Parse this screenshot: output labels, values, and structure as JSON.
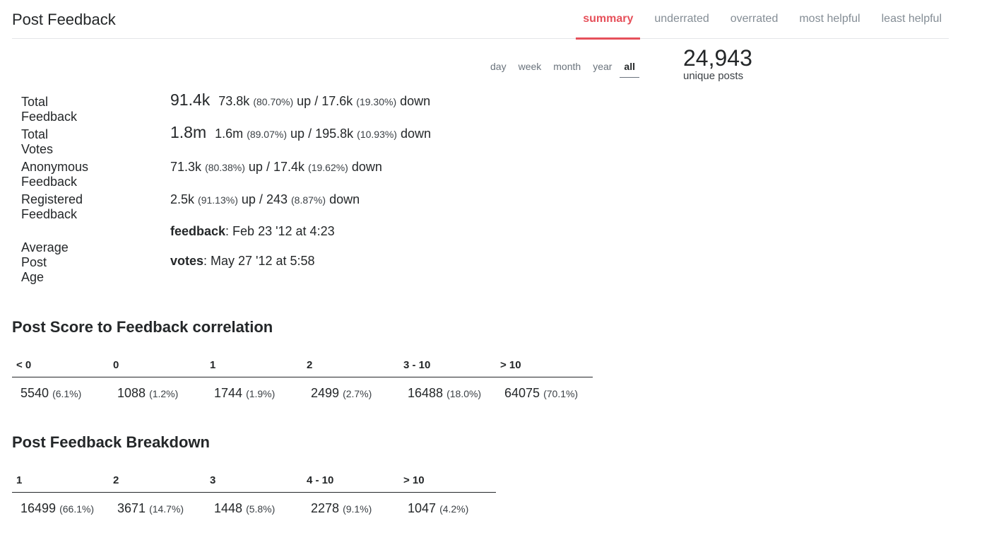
{
  "header": {
    "title": "Post Feedback",
    "tabs": [
      {
        "label": "summary",
        "active": true
      },
      {
        "label": "underrated",
        "active": false
      },
      {
        "label": "overrated",
        "active": false
      },
      {
        "label": "most helpful",
        "active": false
      },
      {
        "label": "least helpful",
        "active": false
      }
    ],
    "accent_color": "#e6505a"
  },
  "periods": [
    {
      "label": "day",
      "active": false
    },
    {
      "label": "week",
      "active": false
    },
    {
      "label": "month",
      "active": false
    },
    {
      "label": "year",
      "active": false
    },
    {
      "label": "all",
      "active": true
    }
  ],
  "unique_posts": {
    "count": "24,943",
    "label": "unique posts"
  },
  "stats": {
    "total_feedback": {
      "label": "Total Feedback",
      "total": "91.4k",
      "up": "73.8k",
      "up_pct": "(80.70%)",
      "down": "17.6k",
      "down_pct": "(19.30%)"
    },
    "total_votes": {
      "label": "Total Votes",
      "total": "1.8m",
      "up": "1.6m",
      "up_pct": "(89.07%)",
      "down": "195.8k",
      "down_pct": "(10.93%)"
    },
    "anonymous_feedback": {
      "label": "Anonymous Feedback",
      "up": "71.3k",
      "up_pct": "(80.38%)",
      "down": "17.4k",
      "down_pct": "(19.62%)"
    },
    "registered_feedback": {
      "label": "Registered Feedback",
      "up": "2.5k",
      "up_pct": "(91.13%)",
      "down": "243",
      "down_pct": "(8.87%)"
    },
    "up_word": "up",
    "down_word": "down",
    "separator": "/",
    "average_post_age": {
      "label": "Average Post Age",
      "feedback_key": "feedback",
      "feedback_value": ": Feb 23 '12 at 4:23",
      "votes_key": "votes",
      "votes_value": ": May 27 '12 at 5:58"
    }
  },
  "score_correlation": {
    "title": "Post Score to Feedback correlation",
    "columns": [
      "< 0",
      "0",
      "1",
      "2",
      "3 - 10",
      "> 10"
    ],
    "values": [
      {
        "count": "5540",
        "pct": "(6.1%)"
      },
      {
        "count": "1088",
        "pct": "(1.2%)"
      },
      {
        "count": "1744",
        "pct": "(1.9%)"
      },
      {
        "count": "2499",
        "pct": "(2.7%)"
      },
      {
        "count": "16488",
        "pct": "(18.0%)"
      },
      {
        "count": "64075",
        "pct": "(70.1%)"
      }
    ]
  },
  "feedback_breakdown": {
    "title": "Post Feedback Breakdown",
    "columns": [
      "1",
      "2",
      "3",
      "4 - 10",
      "> 10"
    ],
    "values": [
      {
        "count": "16499",
        "pct": "(66.1%)"
      },
      {
        "count": "3671",
        "pct": "(14.7%)"
      },
      {
        "count": "1448",
        "pct": "(5.8%)"
      },
      {
        "count": "2278",
        "pct": "(9.1%)"
      },
      {
        "count": "1047",
        "pct": "(4.2%)"
      }
    ]
  }
}
